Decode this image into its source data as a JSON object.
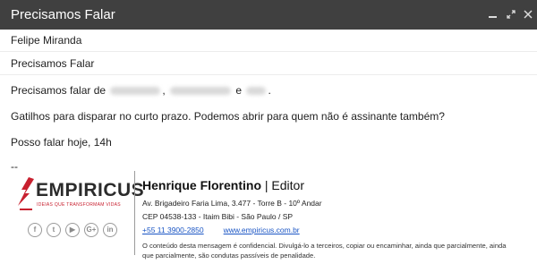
{
  "window": {
    "title": "Precisamos Falar"
  },
  "header": {
    "to": "Felipe Miranda",
    "subject": "Precisamos Falar"
  },
  "body": {
    "line1_prefix": "Precisamos falar de",
    "line1_sep1": ",",
    "line1_sep2": "e",
    "line1_end": ".",
    "line2": "Gatilhos para disparar no curto prazo. Podemos abrir para quem não é assinante também?",
    "line3": "Posso falar hoje, 14h",
    "sig_dash": "--"
  },
  "signature": {
    "logo_text": "EMPIRICUS",
    "logo_tagline": "IDEIAS QUE TRANSFORMAM VIDAS",
    "name": "Henrique Florentino",
    "role": "| Editor",
    "address1": "Av. Brigadeiro Faria Lima, 3.477 - Torre B - 10º Andar",
    "address2": "CEP 04538-133 - Itaim Bibi - São Paulo / SP",
    "phone": "+55 11 3900-2850",
    "website": "www.empiricus.com.br",
    "legal": "O conteúdo desta mensagem é confidencial. Divulgá-lo a terceiros, copiar ou encaminhar, ainda que parcialmente, ainda que parcialmente, são condutas passíveis de penalidade.",
    "socials": {
      "facebook": "f",
      "twitter": "t",
      "youtube": "▶",
      "googleplus": "G+",
      "linkedin": "in"
    }
  },
  "colors": {
    "titlebar": "#404040",
    "logo_red": "#c8202f",
    "link": "#1a55c4"
  },
  "icons": [
    "minimize-icon",
    "expand-icon",
    "close-icon",
    "facebook-icon",
    "twitter-icon",
    "youtube-icon",
    "googleplus-icon",
    "linkedin-icon",
    "empiricus-logo-mark"
  ]
}
